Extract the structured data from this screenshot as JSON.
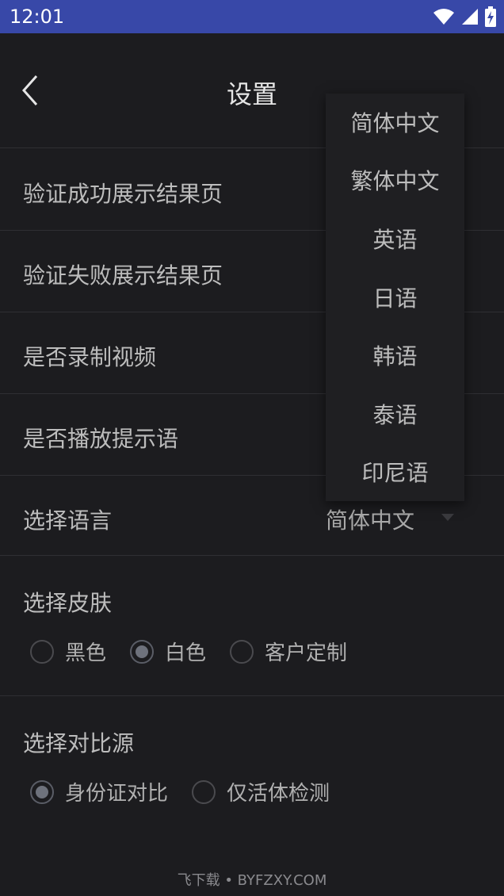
{
  "status_bar": {
    "time": "12:01"
  },
  "header": {
    "title": "设置"
  },
  "settings": {
    "verify_success_label": "验证成功展示结果页",
    "verify_fail_label": "验证失败展示结果页",
    "record_video_label": "是否录制视频",
    "play_prompt_label": "是否播放提示语",
    "language": {
      "label": "选择语言",
      "selected": "简体中文"
    },
    "skin": {
      "label": "选择皮肤",
      "options": [
        {
          "label": "黑色",
          "checked": false
        },
        {
          "label": "白色",
          "checked": true
        },
        {
          "label": "客户定制",
          "checked": false
        }
      ]
    },
    "compare_source": {
      "label": "选择对比源",
      "options": [
        {
          "label": "身份证对比",
          "checked": true
        },
        {
          "label": "仅活体检测",
          "checked": false
        }
      ]
    }
  },
  "language_dropdown": {
    "items": [
      "简体中文",
      "繁体中文",
      "英语",
      "日语",
      "韩语",
      "泰语",
      "印尼语"
    ]
  },
  "watermark": {
    "text": "飞下载 • BYFZXY.COM"
  },
  "icons": [
    "wifi-icon",
    "signal-icon",
    "battery-icon",
    "back-icon",
    "caret-down-icon"
  ],
  "colors": {
    "status_bar": "#3848a8",
    "background": "#1c1c1f"
  }
}
